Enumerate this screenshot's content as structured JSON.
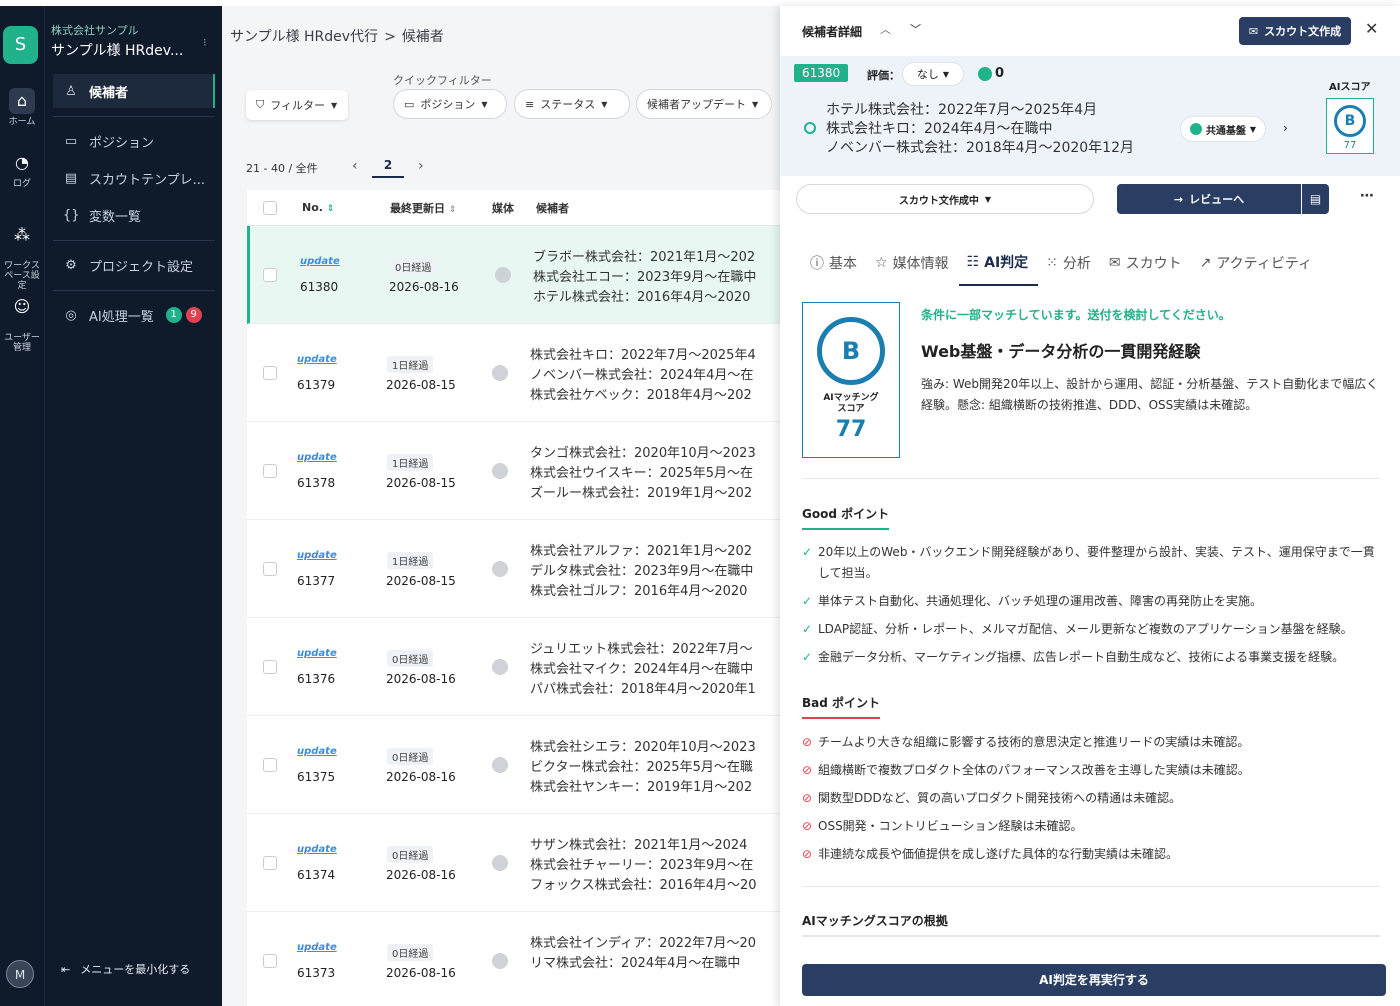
{
  "rail": {
    "logo_letter": "S",
    "items": [
      {
        "label": "ホーム",
        "icon": "home-icon",
        "glyph": "⌂"
      },
      {
        "label": "ログ",
        "icon": "log-icon",
        "glyph": "◔"
      },
      {
        "label": "ワークス\nペース設定",
        "icon": "workspace-icon",
        "glyph": "⁂"
      },
      {
        "label": "ユーザー\n管理",
        "icon": "user-manage-icon",
        "glyph": "☺"
      }
    ],
    "avatar_letter": "M"
  },
  "sidebar": {
    "org": "株式会社サンプル",
    "project": "サンプル様 HRdev...",
    "items": [
      {
        "label": "候補者",
        "glyph": "♙"
      },
      {
        "label": "ポジション",
        "glyph": "▭"
      },
      {
        "label": "スカウトテンプレ...",
        "glyph": "▤"
      },
      {
        "label": "変数一覧",
        "glyph": "{}"
      },
      {
        "label": "プロジェクト設定",
        "glyph": "⚙"
      },
      {
        "label": "AI処理一覧",
        "glyph": "◎",
        "badge_green": "1",
        "badge_red": "9"
      }
    ],
    "minimize": "メニューを最小化する"
  },
  "main": {
    "breadcrumb": [
      "サンプル様 HRdev代行",
      "候補者"
    ],
    "filter_label": "フィルター",
    "quick_filter_label": "クイックフィルター",
    "quick_filters": [
      "ポジション",
      "ステータス",
      "候補者アップデート"
    ],
    "pager_text": "21 - 40 / 全件",
    "current_page": "2",
    "columns": [
      "No.",
      "最終更新日",
      "媒体",
      "候補者"
    ],
    "rows": [
      {
        "tag": "update",
        "no": "61380",
        "elapsed": "0日経過",
        "date": "2026-08-16",
        "c1": "ブラボー株式会社：2021年1月〜202",
        "c2": "株式会社エコー：2023年9月〜在職中",
        "c3": "ホテル株式会社：2016年4月〜2020"
      },
      {
        "tag": "update",
        "no": "61379",
        "elapsed": "1日経過",
        "date": "2026-08-15",
        "c1": "株式会社キロ：2022年7月〜2025年4",
        "c2": "ノベンバー株式会社：2024年4月〜在",
        "c3": "株式会社ケベック：2018年4月〜202"
      },
      {
        "tag": "update",
        "no": "61378",
        "elapsed": "1日経過",
        "date": "2026-08-15",
        "c1": "タンゴ株式会社：2020年10月〜2023",
        "c2": "株式会社ウイスキー：2025年5月〜在",
        "c3": "ズールー株式会社：2019年1月〜202"
      },
      {
        "tag": "update",
        "no": "61377",
        "elapsed": "1日経過",
        "date": "2026-08-15",
        "c1": "株式会社アルファ：2021年1月〜202",
        "c2": "デルタ株式会社：2023年9月〜在職中",
        "c3": "株式会社ゴルフ：2016年4月〜2020"
      },
      {
        "tag": "update",
        "no": "61376",
        "elapsed": "0日経過",
        "date": "2026-08-16",
        "c1": "ジュリエット株式会社：2022年7月〜",
        "c2": "株式会社マイク：2024年4月〜在職中",
        "c3": "パパ株式会社：2018年4月〜2020年1"
      },
      {
        "tag": "update",
        "no": "61375",
        "elapsed": "0日経過",
        "date": "2026-08-16",
        "c1": "株式会社シエラ：2020年10月〜2023",
        "c2": "ビクター株式会社：2025年5月〜在職",
        "c3": "株式会社ヤンキー：2019年1月〜202"
      },
      {
        "tag": "update",
        "no": "61374",
        "elapsed": "0日経過",
        "date": "2026-08-16",
        "c1": "サザン株式会社：2021年1月〜2024",
        "c2": "株式会社チャーリー：2023年9月〜在",
        "c3": "フォックス株式会社：2016年4月〜20"
      },
      {
        "tag": "update",
        "no": "61373",
        "elapsed": "0日経過",
        "date": "2026-08-16",
        "c1": "株式会社インディア：2022年7月〜20",
        "c2": "リマ株式会社：2024年4月〜在職中",
        "c3": ""
      }
    ]
  },
  "panel": {
    "title": "候補者詳細",
    "scout_button": "スカウト文作成",
    "candidate_id": "61380",
    "eval_label": "評価：",
    "eval_value": "なし",
    "message_count": "0",
    "careers": [
      "ホテル株式会社：2022年7月〜2025年4月",
      "株式会社キロ：2024年4月〜在職中",
      "ノベンバー株式会社：2018年4月〜2020年12月"
    ],
    "base_select": "共通基盤",
    "ai_score_label": "AIスコア",
    "ai_grade": "B",
    "ai_score": "77",
    "scout_status": "スカウト文作成中",
    "review_button": "レビューへ",
    "tabs": [
      {
        "label": "基本",
        "glyph": "ⓘ"
      },
      {
        "label": "媒体情報",
        "glyph": "☆"
      },
      {
        "label": "AI判定",
        "glyph": "☷"
      },
      {
        "label": "分析",
        "glyph": "⁙"
      },
      {
        "label": "スカウト",
        "glyph": "✉"
      },
      {
        "label": "アクティビティ",
        "glyph": "↗"
      }
    ],
    "score_card_label_1": "AIマッチング",
    "score_card_label_2": "スコア",
    "judgement": "条件に一部マッチしています。送付を検討してください。",
    "headline": "Web基盤・データ分析の一貫開発経験",
    "description": "強み: Web開発20年以上、設計から運用、認証・分析基盤、テスト自動化まで幅広く経験。懸念: 組織横断の技術推進、DDD、OSS実績は未確認。",
    "good_title": "Good ポイント",
    "good_points": [
      "20年以上のWeb・バックエンド開発経験があり、要件整理から設計、実装、テスト、運用保守まで一貫して担当。",
      "単体テスト自動化、共通処理化、バッチ処理の運用改善、障害の再発防止を実施。",
      "LDAP認証、分析・レポート、メルマガ配信、メール更新など複数のアプリケーション基盤を経験。",
      "金融データ分析、マーケティング指標、広告レポート自動生成など、技術による事業支援を経験。"
    ],
    "bad_title": "Bad ポイント",
    "bad_points": [
      "チームより大きな組織に影響する技術的意思決定と推進リードの実績は未確認。",
      "組織横断で複数プロダクト全体のパフォーマンス改善を主導した実績は未確認。",
      "関数型DDDなど、質の高いプロダクト開発技術への精通は未確認。",
      "OSS開発・コントリビューション経験は未確認。",
      "非連続な成長や価値提供を成し遂げた具体的な行動実績は未確認。"
    ],
    "basis_title": "AIマッチングスコアの根拠",
    "rerun_button": "AI判定を再実行する"
  },
  "colors": {
    "accent": "#20b28a",
    "navy": "#2a3d62",
    "sidebar_bg": "#0f1a2b",
    "score_blue": "#1a7fb0",
    "danger": "#e0434f"
  }
}
